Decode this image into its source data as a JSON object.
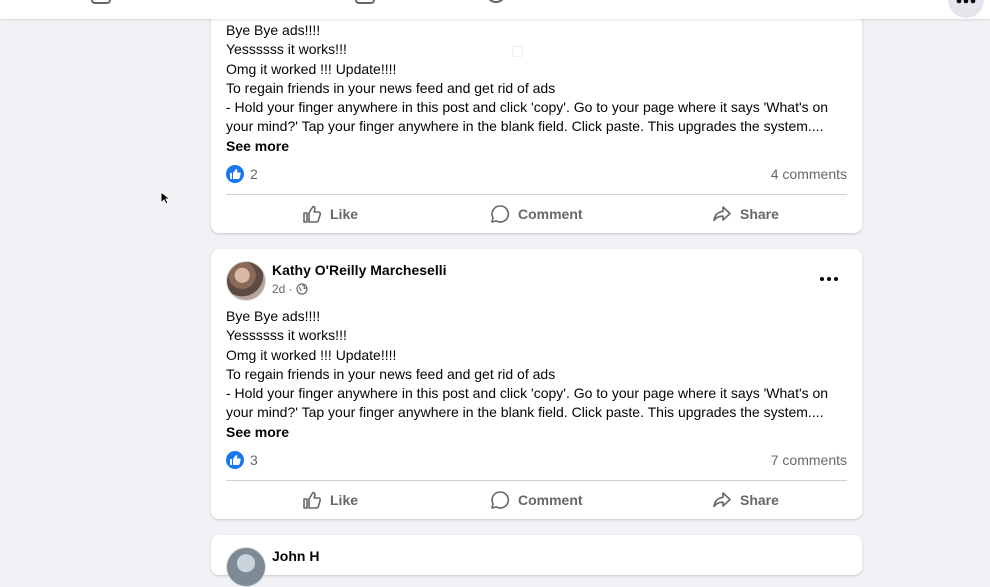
{
  "topbar": {
    "icons": [
      "nav-icon-1",
      "nav-icon-2",
      "nav-icon-3",
      "nav-icon-4",
      "nav-icon-5",
      "menu-icon"
    ]
  },
  "posts": [
    {
      "body": [
        "Bye Bye ads!!!!",
        "Yessssss it works!!!",
        "Omg it worked !!! Update!!!!",
        "To regain friends in your news feed and get rid of ads",
        " - Hold your finger anywhere in this post and click 'copy'. Go to your page where it says 'What's on your mind?' Tap your finger anywhere in the blank field. Click paste. This upgrades the system....",
        "See more"
      ],
      "reactions": "2",
      "comments": "4 comments",
      "like_label": "Like",
      "comment_label": "Comment",
      "share_label": "Share"
    },
    {
      "author": "Kathy O'Reilly Marcheselli",
      "time": "2d · ",
      "audience_icon": "globe-icon",
      "body": [
        "Bye Bye ads!!!!",
        "Yessssss it works!!!",
        "Omg it worked !!! Update!!!!",
        "To regain friends in your news feed and get rid of ads",
        " - Hold your finger anywhere in this post and click 'copy'. Go to your page where it says 'What's on your mind?' Tap your finger anywhere in the blank field. Click paste. This upgrades the system....",
        "See more"
      ],
      "reactions": "3",
      "comments": "7 comments",
      "like_label": "Like",
      "comment_label": "Comment",
      "share_label": "Share"
    },
    {
      "author": "John H"
    }
  ],
  "colors": {
    "background": "#f0f2f5",
    "card": "#ffffff",
    "like_blue": "#1877f2",
    "secondary_text": "#65676b"
  }
}
